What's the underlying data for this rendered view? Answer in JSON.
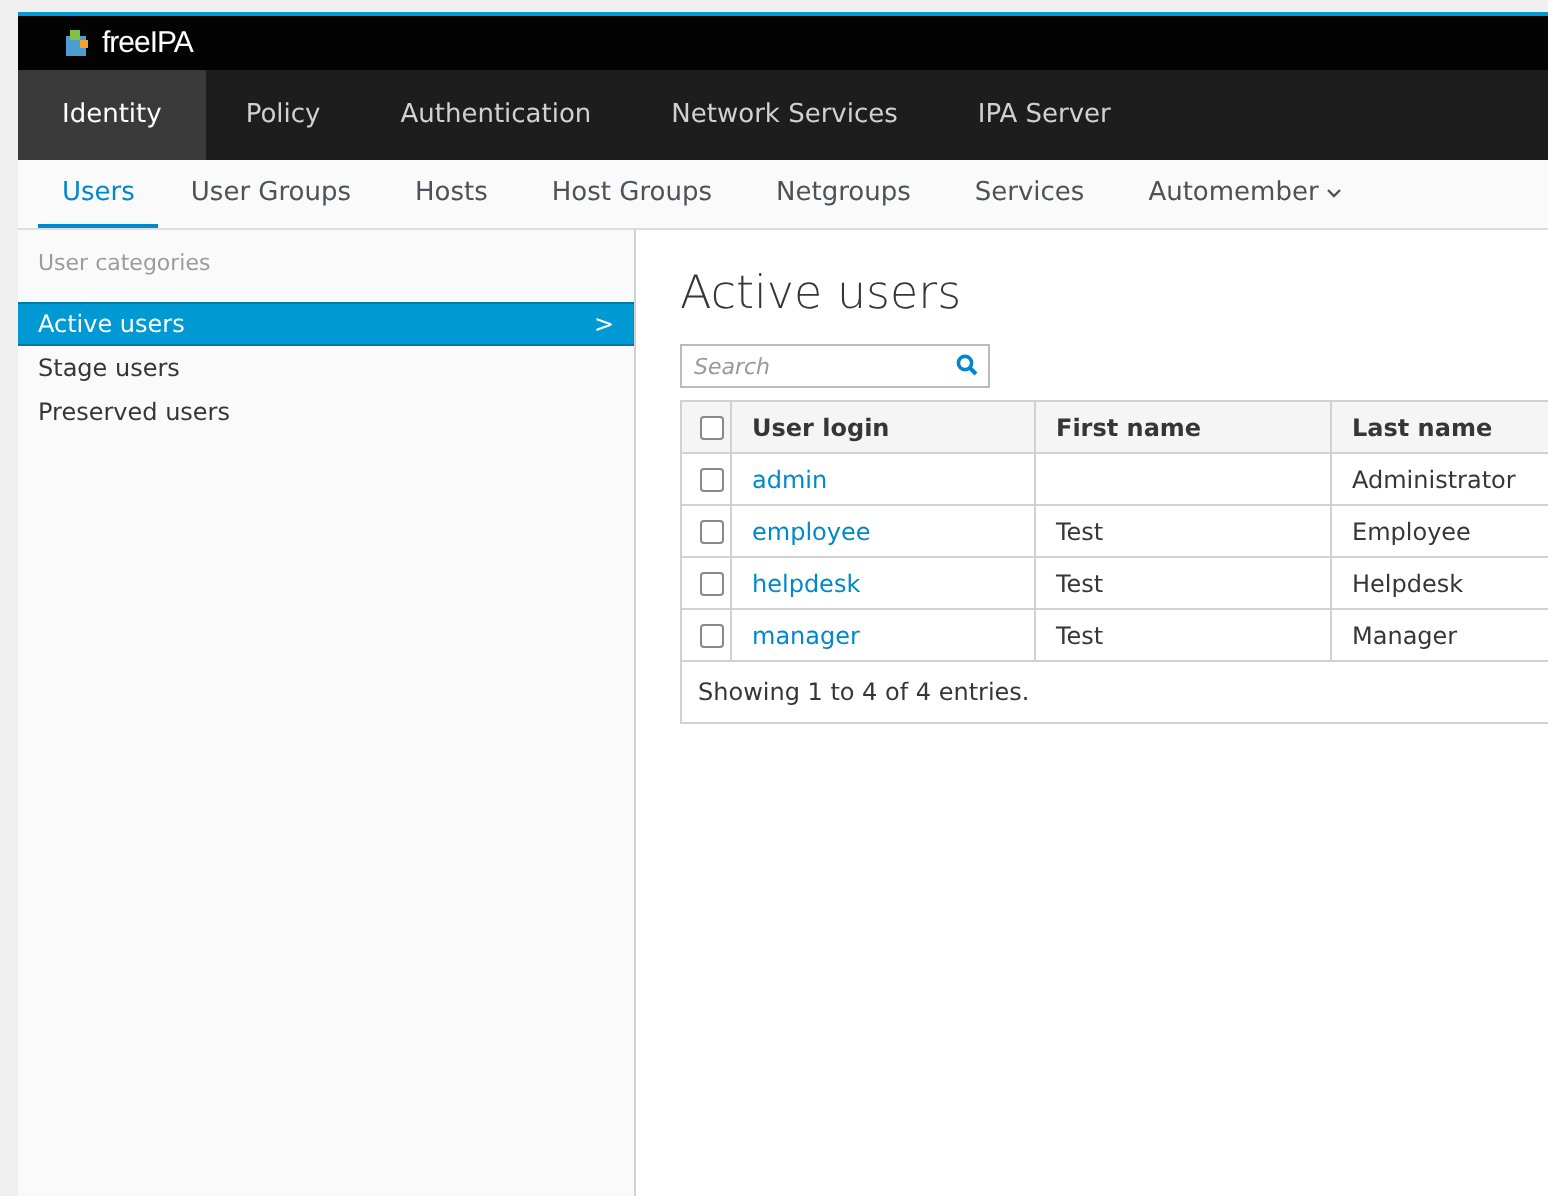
{
  "brand": {
    "name": "freeIPA"
  },
  "nav": [
    {
      "label": "Identity",
      "selected": true
    },
    {
      "label": "Policy",
      "selected": false
    },
    {
      "label": "Authentication",
      "selected": false
    },
    {
      "label": "Network Services",
      "selected": false
    },
    {
      "label": "IPA Server",
      "selected": false
    }
  ],
  "subnav": [
    {
      "label": "Users",
      "selected": true
    },
    {
      "label": "User Groups",
      "selected": false
    },
    {
      "label": "Hosts",
      "selected": false
    },
    {
      "label": "Host Groups",
      "selected": false
    },
    {
      "label": "Netgroups",
      "selected": false
    },
    {
      "label": "Services",
      "selected": false
    },
    {
      "label": "Automember",
      "selected": false,
      "dropdown": true
    }
  ],
  "sidebar": {
    "heading": "User categories",
    "items": [
      {
        "label": "Active users",
        "selected": true,
        "chevron": ">"
      },
      {
        "label": "Stage users",
        "selected": false
      },
      {
        "label": "Preserved users",
        "selected": false
      }
    ]
  },
  "page_title": "Active users",
  "search": {
    "placeholder": "Search"
  },
  "table": {
    "select_all_checked": false,
    "columns": [
      "User login",
      "First name",
      "Last name"
    ],
    "rows": [
      {
        "checked": false,
        "cells": [
          "admin",
          "",
          "Administrator"
        ]
      },
      {
        "checked": false,
        "cells": [
          "employee",
          "Test",
          "Employee"
        ]
      },
      {
        "checked": false,
        "cells": [
          "helpdesk",
          "Test",
          "Helpdesk"
        ]
      },
      {
        "checked": false,
        "cells": [
          "manager",
          "Test",
          "Manager"
        ]
      }
    ],
    "footer": "Showing 1 to 4 of 4 entries."
  }
}
